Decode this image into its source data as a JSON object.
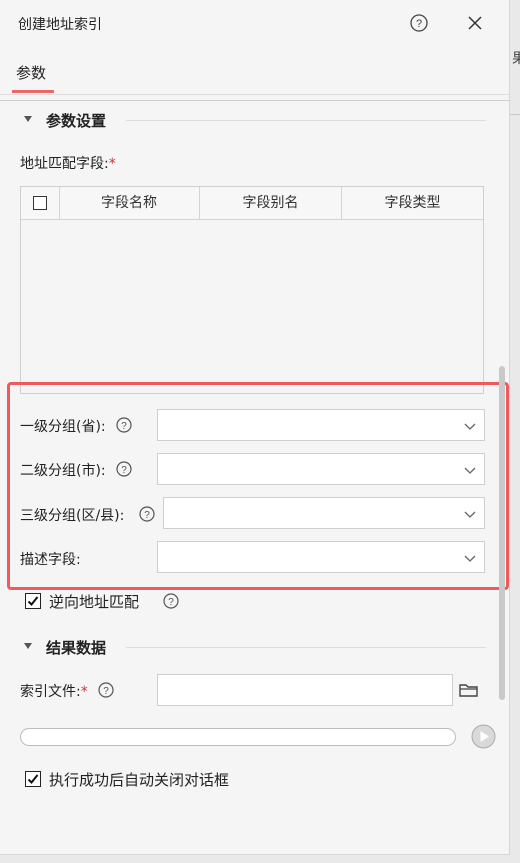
{
  "window": {
    "title": "创建地址索引"
  },
  "tabs": [
    {
      "label": "参数",
      "active": true
    }
  ],
  "params_section": {
    "title": "参数设置",
    "address_field_label": "地址匹配字段:",
    "required_mark": "*",
    "table": {
      "columns": [
        "字段名称",
        "字段别名",
        "字段类型"
      ],
      "rows": []
    },
    "groups": [
      {
        "label": "一级分组(省):",
        "value": ""
      },
      {
        "label": "二级分组(市):",
        "value": ""
      },
      {
        "label": "三级分组(区/县):",
        "value": ""
      },
      {
        "label": "描述字段:",
        "value": ""
      }
    ],
    "reverse_match": {
      "label": "逆向地址匹配",
      "checked": true
    }
  },
  "result_section": {
    "title": "结果数据",
    "index_file_label": "索引文件:",
    "required_mark": "*",
    "index_file_value": ""
  },
  "progress": {
    "value": 0
  },
  "auto_close": {
    "label": "执行成功后自动关闭对话框",
    "checked": true
  },
  "background": {
    "fragment": "果"
  },
  "colors": {
    "accent": "#e66a6a",
    "highlight": "#ef5a5e",
    "required": "#d32f2f"
  }
}
